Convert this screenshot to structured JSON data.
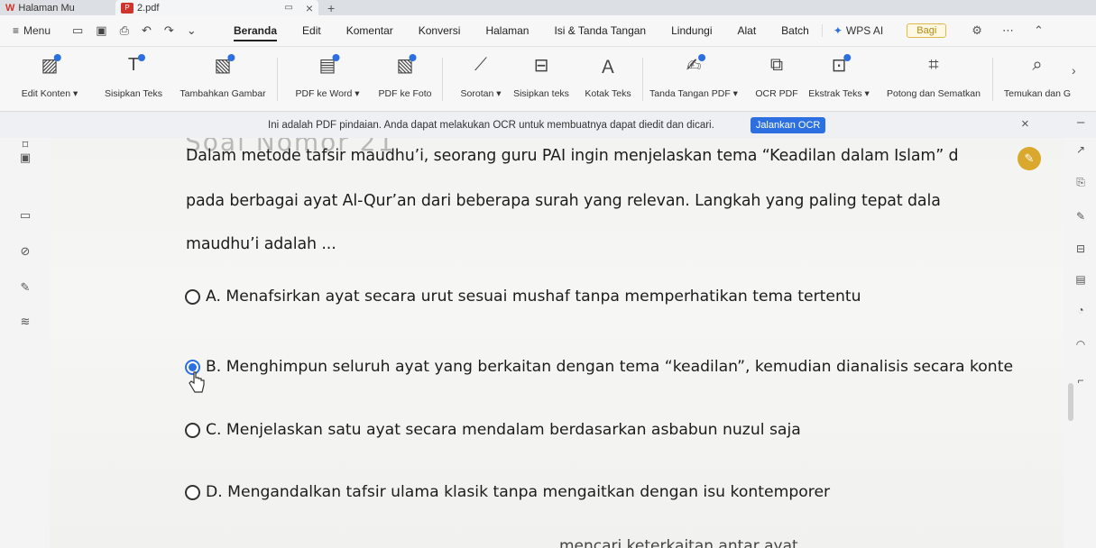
{
  "tabs": [
    {
      "label": "Halaman Mu"
    },
    {
      "label": "2.pdf"
    }
  ],
  "menubar": {
    "menu_label": "Menu",
    "tabs": [
      "Beranda",
      "Edit",
      "Komentar",
      "Konversi",
      "Halaman",
      "Isi & Tanda Tangan",
      "Lindungi",
      "Alat",
      "Batch"
    ],
    "active_tab": "Beranda",
    "wps_ai": "WPS AI",
    "share": "Bagi"
  },
  "ribbon": {
    "buttons": [
      {
        "label": "Edit Konten ▾",
        "icon": "edit-content-icon"
      },
      {
        "label": "Sisipkan Teks",
        "icon": "insert-text-icon"
      },
      {
        "label": "Tambahkan Gambar",
        "icon": "add-image-icon"
      },
      {
        "label": "PDF ke Word ▾",
        "icon": "pdf-to-word-icon"
      },
      {
        "label": "PDF ke Foto",
        "icon": "pdf-to-photo-icon"
      },
      {
        "label": "Sorotan ▾",
        "icon": "highlight-icon"
      },
      {
        "label": "Sisipkan teks",
        "icon": "insert-textbox-icon"
      },
      {
        "label": "Kotak Teks",
        "icon": "textbox-icon"
      },
      {
        "label": "Tanda Tangan PDF ▾",
        "icon": "signature-icon"
      },
      {
        "label": "OCR PDF",
        "icon": "ocr-icon"
      },
      {
        "label": "Ekstrak Teks ▾",
        "icon": "extract-text-icon"
      },
      {
        "label": "Potong dan Sematkan",
        "icon": "crop-icon"
      },
      {
        "label": "Temukan dan G",
        "icon": "search-icon"
      }
    ]
  },
  "banner": {
    "text": "Ini adalah PDF pindaian. Anda dapat melakukan OCR untuk membuatnya dapat diedit dan dicari.",
    "button": "Jalankan OCR"
  },
  "question": {
    "header_fragment": "Soal Nomor 21",
    "lines": [
      "Dalam metode tafsir maudhu’i, seorang guru PAI ingin menjelaskan tema “Keadilan dalam Islam” d",
      "pada berbagai ayat Al-Qur’an dari beberapa surah yang relevan. Langkah yang paling tepat dala",
      "maudhu’i adalah ..."
    ],
    "options": [
      {
        "text": "A. Menafsirkan ayat secara urut sesuai mushaf tanpa memperhatikan tema tertentu",
        "selected": false
      },
      {
        "text": "B. Menghimpun seluruh ayat yang berkaitan dengan tema “keadilan”, kemudian dianalisis secara konte",
        "selected": true
      },
      {
        "text": "C. Menjelaskan satu ayat secara mendalam berdasarkan asbabun nuzul saja",
        "selected": false
      },
      {
        "text": "D. Mengandalkan tafsir ulama klasik tanpa mengaitkan dengan isu kontemporer",
        "selected": false
      }
    ],
    "footer_fragment": "mencari keterkaitan antar ayat"
  },
  "colors": {
    "accent": "#2b6fe0",
    "brand": "#d0342c",
    "share": "#b58a10"
  }
}
